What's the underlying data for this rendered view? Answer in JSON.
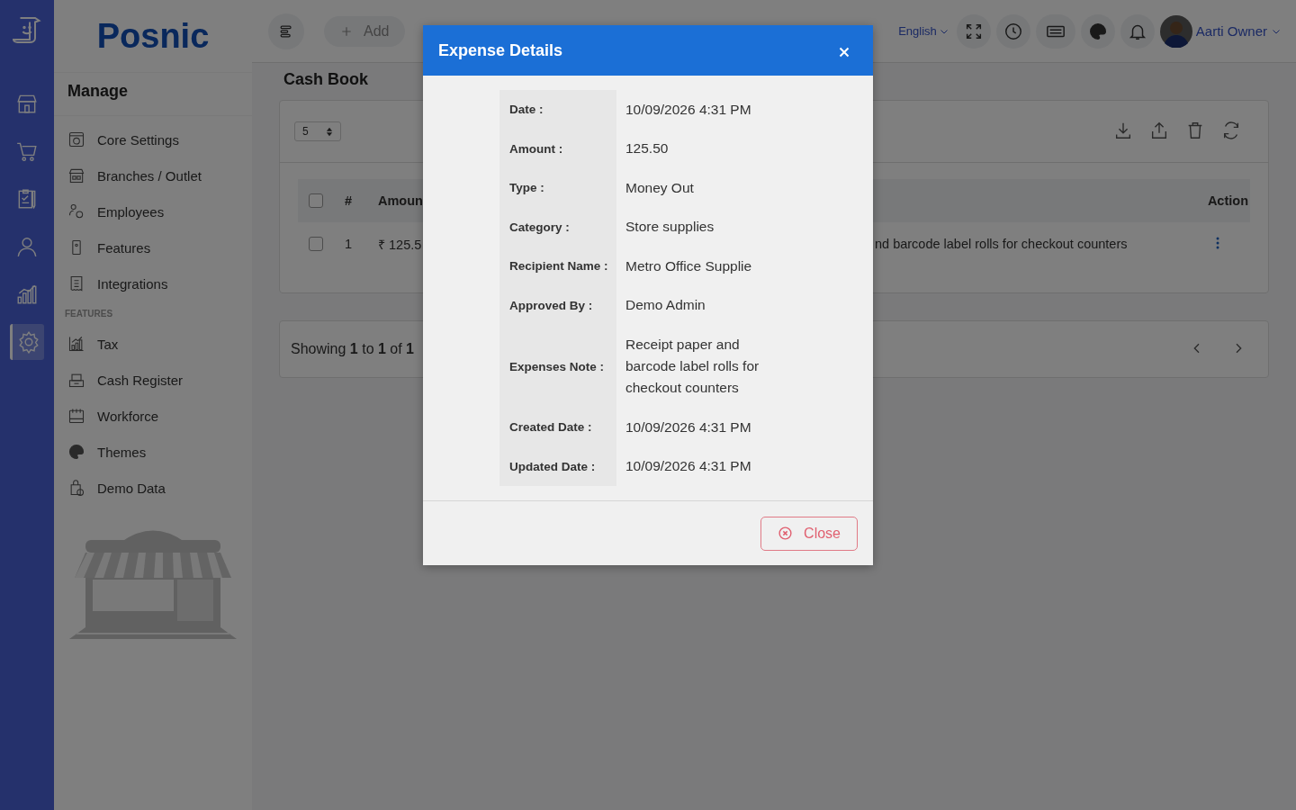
{
  "rail": [
    {
      "selected": false
    },
    {
      "selected": false
    },
    {
      "selected": false
    },
    {
      "selected": false
    },
    {
      "selected": false
    },
    {
      "selected": true
    }
  ],
  "sidebar": {
    "logo": "Posnic",
    "heading": "Manage",
    "groups": [
      {
        "items": [
          "Core Settings",
          "Branches / Outlet",
          "Employees",
          "Features",
          "Integrations"
        ]
      },
      {
        "title": "FEATURES",
        "items": [
          "Tax",
          "Cash Register",
          "Workforce",
          "Themes",
          "Demo Data"
        ]
      }
    ]
  },
  "topbar": {
    "add": "Add",
    "language": "English",
    "user": "Aarti Owner"
  },
  "page_title": "Cash Book",
  "table": {
    "page_size": "5",
    "columns": [
      "#",
      "Amoun",
      "Action"
    ],
    "rows": [
      {
        "checked": false,
        "cells": [
          "1",
          "₹ 125.5",
          "nd barcode label rolls for checkout counters"
        ]
      }
    ],
    "header_checked": false
  },
  "pagination": {
    "summary": "Showing **1** to **1** of **1**"
  },
  "modal": {
    "title": "Expense Details",
    "fields": [
      {
        "label": "Date :",
        "value": "10/09/2026 4:31 PM"
      },
      {
        "label": "Amount :",
        "value": "125.50"
      },
      {
        "label": "Type :",
        "value": "Money Out"
      },
      {
        "label": "Category :",
        "value": "Store supplies"
      },
      {
        "label": "Recipient Name :",
        "value": "Metro Office Supplie"
      },
      {
        "label": "Approved By :",
        "value": "Demo Admin"
      },
      {
        "label": "Expenses Note :",
        "value": "Receipt paper and barcode label rolls for checkout counters"
      },
      {
        "label": "Created Date :",
        "value": "10/09/2026 4:31 PM"
      },
      {
        "label": "Updated Date :",
        "value": "10/09/2026 4:31 PM"
      }
    ],
    "close": "Close"
  }
}
